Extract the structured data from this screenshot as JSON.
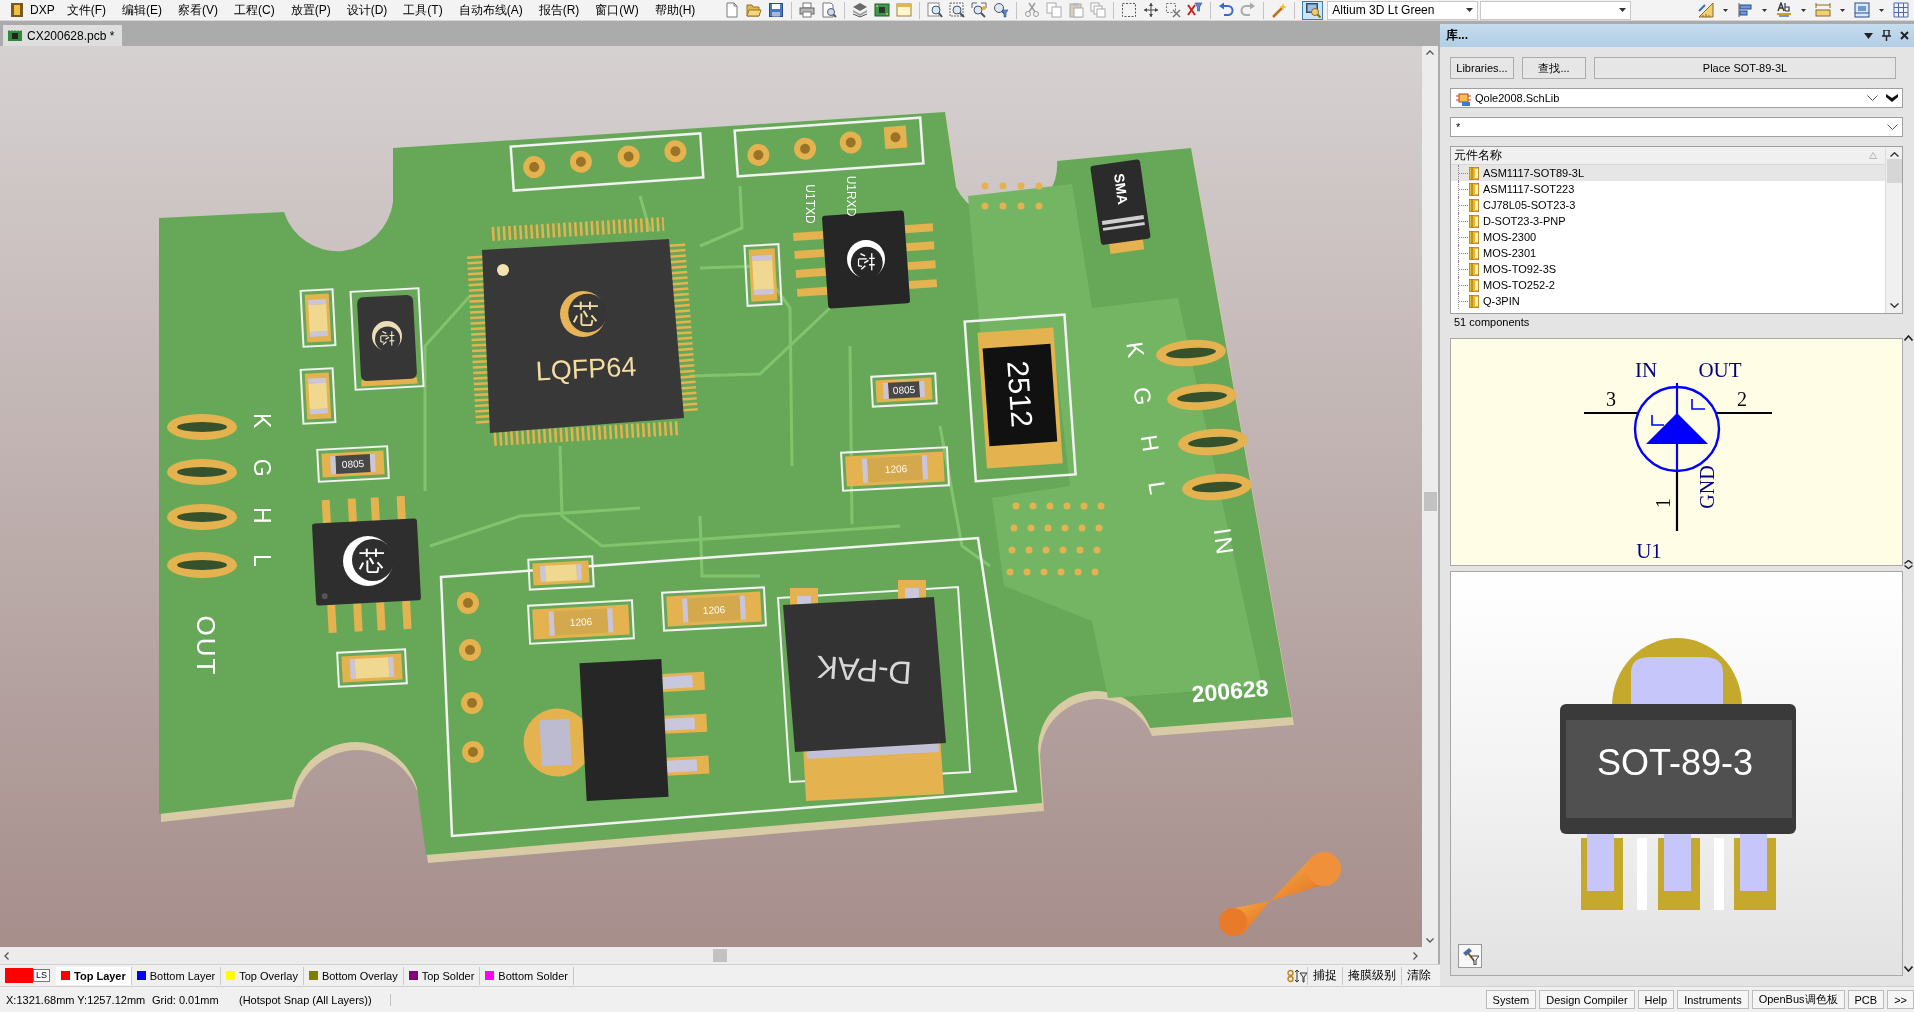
{
  "menu_bar": {
    "logo": "DXP",
    "items": [
      "文件(F)",
      "编辑(E)",
      "察看(V)",
      "工程(C)",
      "放置(P)",
      "设计(D)",
      "工具(T)",
      "自动布线(A)",
      "报告(R)",
      "窗口(W)",
      "帮助(H)"
    ],
    "view_configuration": "Altium 3D Lt Green"
  },
  "document_tabs": [
    {
      "label": "CX200628.pcb *",
      "selected": true
    }
  ],
  "pcb_3d_view": {
    "chip_logos": [
      "芯",
      "芯",
      "芯",
      "芯"
    ],
    "qfp_label": "LQFP64",
    "power_resistor_label": "2512",
    "diode_label": "SMA",
    "dpak_label": "D-PAK",
    "board_code": "200628",
    "left_pad_labels": "K G H L",
    "right_pad_labels": "K G H L",
    "output_label": "OUT",
    "input_label": "IN",
    "header_labels": [
      "U1TXD",
      "U1RXD"
    ],
    "size_labels": [
      "0805",
      "0805",
      "1206",
      "1206",
      "1206"
    ]
  },
  "layer_set": "LS",
  "layer_tabs": [
    {
      "label": "Top Layer",
      "color": "#ff0000",
      "selected": true
    },
    {
      "label": "Bottom Layer",
      "color": "#0000ff",
      "selected": false
    },
    {
      "label": "Top Overlay",
      "color": "#ffff00",
      "selected": false
    },
    {
      "label": "Bottom Overlay",
      "color": "#808000",
      "selected": false
    },
    {
      "label": "Top Solder",
      "color": "#800080",
      "selected": false
    },
    {
      "label": "Bottom Solder",
      "color": "#ff00ff",
      "selected": false
    }
  ],
  "snap_controls": [
    "捕捉",
    "掩膜级别",
    "清除"
  ],
  "library_panel": {
    "title": "库...",
    "buttons": [
      "Libraries...",
      "查找...",
      "Place SOT-89-3L"
    ],
    "library": "Qole2008.SchLib",
    "filter": "*",
    "column": "元件名称",
    "components": [
      {
        "name": "ASM1117-SOT89-3L",
        "selected": true
      },
      {
        "name": "ASM1117-SOT223",
        "selected": false
      },
      {
        "name": "CJ78L05-SOT23-3",
        "selected": false
      },
      {
        "name": "D-SOT23-3-PNP",
        "selected": false
      },
      {
        "name": "MOS-2300",
        "selected": false
      },
      {
        "name": "MOS-2301",
        "selected": false
      },
      {
        "name": "MOS-TO92-3S",
        "selected": false
      },
      {
        "name": "MOS-TO252-2",
        "selected": false
      },
      {
        "name": "Q-3PIN",
        "selected": false
      }
    ],
    "count": "51 components",
    "symbol": {
      "pin_names": [
        "IN",
        "OUT",
        "GND"
      ],
      "pin_numbers": [
        "3",
        "2",
        "1"
      ],
      "designator": "U1"
    },
    "model_label": "SOT-89-3"
  },
  "status_bar": {
    "coordinates": "X:1321.68mm Y:1257.12mm",
    "grid": "Grid: 0.01mm",
    "snap_mode": "(Hotspot Snap (All Layers))",
    "panels": [
      "System",
      "Design Compiler",
      "Help",
      "Instruments",
      "OpenBus调色板",
      "PCB",
      ">>"
    ]
  }
}
